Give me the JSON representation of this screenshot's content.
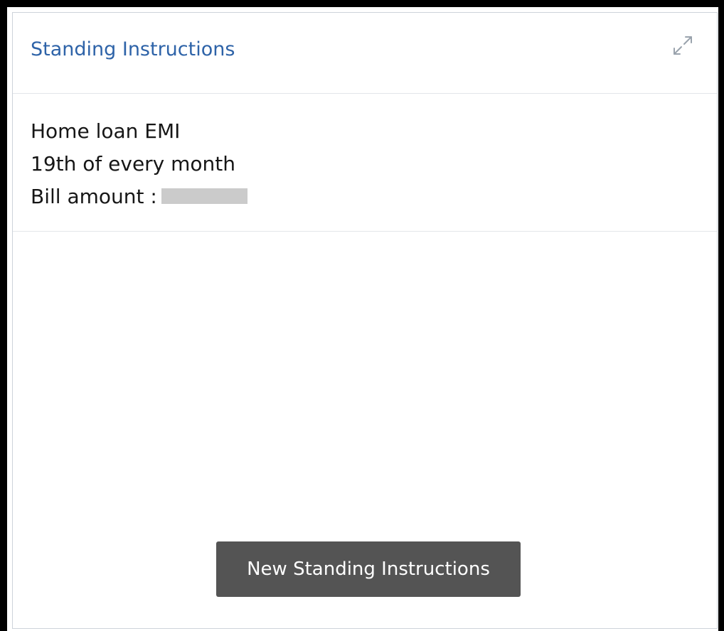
{
  "widget": {
    "title": "Standing Instructions",
    "expand_icon": "expand-arrows-icon",
    "accent_color": "#2e63a8"
  },
  "instructions": [
    {
      "name": "Home loan EMI",
      "schedule": "19th of every month",
      "amount_label": "Bill amount :",
      "amount_value_masked": true
    }
  ],
  "actions": {
    "new_label": "New Standing Instructions",
    "button_color": "#545454"
  }
}
